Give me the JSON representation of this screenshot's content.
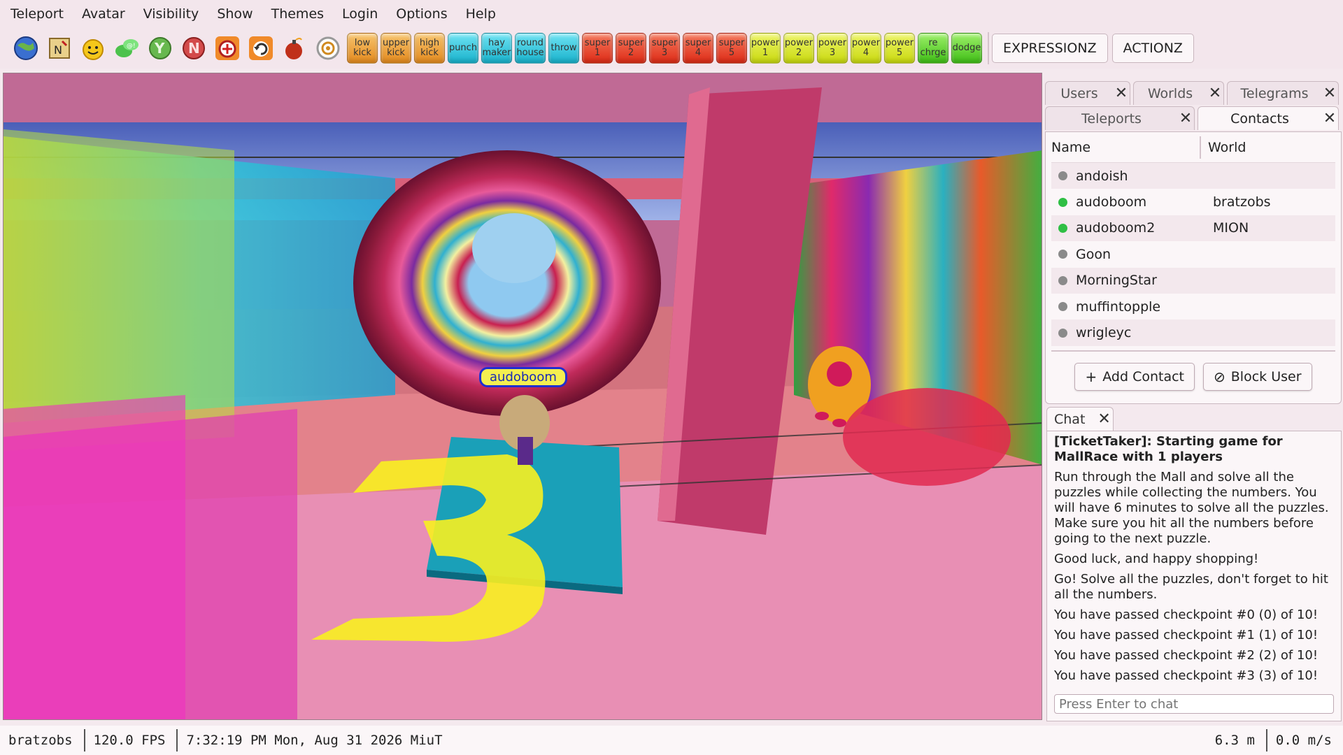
{
  "menu": [
    "Teleport",
    "Avatar",
    "Visibility",
    "Show",
    "Themes",
    "Login",
    "Options",
    "Help"
  ],
  "toolbar": {
    "icons": [
      "globe-icon",
      "map-icon",
      "smiley-icon",
      "chat-bubbles-icon",
      "yes-icon",
      "no-icon",
      "add-teleport-icon",
      "teleport-back-icon",
      "bomb-icon",
      "target-icon"
    ],
    "actions": [
      {
        "l1": "low",
        "l2": "kick",
        "color": "orange"
      },
      {
        "l1": "upper",
        "l2": "kick",
        "color": "orange"
      },
      {
        "l1": "high",
        "l2": "kick",
        "color": "orange"
      },
      {
        "l1": "punch",
        "l2": "",
        "color": "cyan"
      },
      {
        "l1": "hay",
        "l2": "maker",
        "color": "cyan"
      },
      {
        "l1": "round",
        "l2": "house",
        "color": "cyan"
      },
      {
        "l1": "throw",
        "l2": "",
        "color": "cyan"
      },
      {
        "l1": "super",
        "l2": "1",
        "color": "red"
      },
      {
        "l1": "super",
        "l2": "2",
        "color": "red"
      },
      {
        "l1": "super",
        "l2": "3",
        "color": "red"
      },
      {
        "l1": "super",
        "l2": "4",
        "color": "red"
      },
      {
        "l1": "super",
        "l2": "5",
        "color": "red"
      },
      {
        "l1": "power",
        "l2": "1",
        "color": "yellow"
      },
      {
        "l1": "power",
        "l2": "2",
        "color": "yellow"
      },
      {
        "l1": "power",
        "l2": "3",
        "color": "yellow"
      },
      {
        "l1": "power",
        "l2": "4",
        "color": "yellow"
      },
      {
        "l1": "power",
        "l2": "5",
        "color": "yellow"
      },
      {
        "l1": "re",
        "l2": "chrge",
        "color": "green"
      },
      {
        "l1": "dodge",
        "l2": "",
        "color": "green"
      }
    ],
    "expressions_label": "EXPRESSIONZ",
    "actions_label": "ACTIONZ"
  },
  "viewport": {
    "nametag": "audoboom"
  },
  "panel": {
    "tabs_row1": [
      "Users",
      "Worlds",
      "Telegrams"
    ],
    "tabs_row2": [
      "Teleports",
      "Contacts"
    ],
    "active_tab": "Contacts",
    "contacts": {
      "col_name": "Name",
      "col_world": "World",
      "rows": [
        {
          "name": "andoish",
          "world": "",
          "online": false
        },
        {
          "name": "audoboom",
          "world": "bratzobs",
          "online": true
        },
        {
          "name": "audoboom2",
          "world": "MION",
          "online": true
        },
        {
          "name": "Goon",
          "world": "",
          "online": false
        },
        {
          "name": "MorningStar",
          "world": "",
          "online": false
        },
        {
          "name": "muffintopple",
          "world": "",
          "online": false
        },
        {
          "name": "wrigleyc",
          "world": "",
          "online": false
        }
      ],
      "add_label": "Add Contact",
      "block_label": "Block User"
    }
  },
  "chat": {
    "tab_label": "Chat",
    "messages": [
      {
        "text": "[TicketTaker]:    Starting game for MallRace with 1 players",
        "bold": true
      },
      {
        "text": "Run through the Mall and solve all the puzzles while collecting the numbers.  You will have 6 minutes to solve all the puzzles. Make sure you hit all the numbers before going to the next puzzle.",
        "bold": false
      },
      {
        "text": "Good luck, and happy shopping!",
        "bold": false
      },
      {
        "text": "Go! Solve all the puzzles, don't forget to hit all the numbers.",
        "bold": false
      },
      {
        "text": "You have passed checkpoint #0 (0) of 10!",
        "bold": false
      },
      {
        "text": "You have passed checkpoint #1 (1) of 10!",
        "bold": false
      },
      {
        "text": "You have passed checkpoint #2 (2) of 10!",
        "bold": false
      },
      {
        "text": "You have passed checkpoint #3 (3) of 10!",
        "bold": false
      }
    ],
    "placeholder": "Press Enter to chat"
  },
  "status": {
    "world": "bratzobs",
    "fps": "120.0 FPS",
    "time": "7:32:19 PM Mon, Aug 31 2026 MiuT",
    "distance": "6.3 m",
    "speed": "0.0 m/s"
  }
}
